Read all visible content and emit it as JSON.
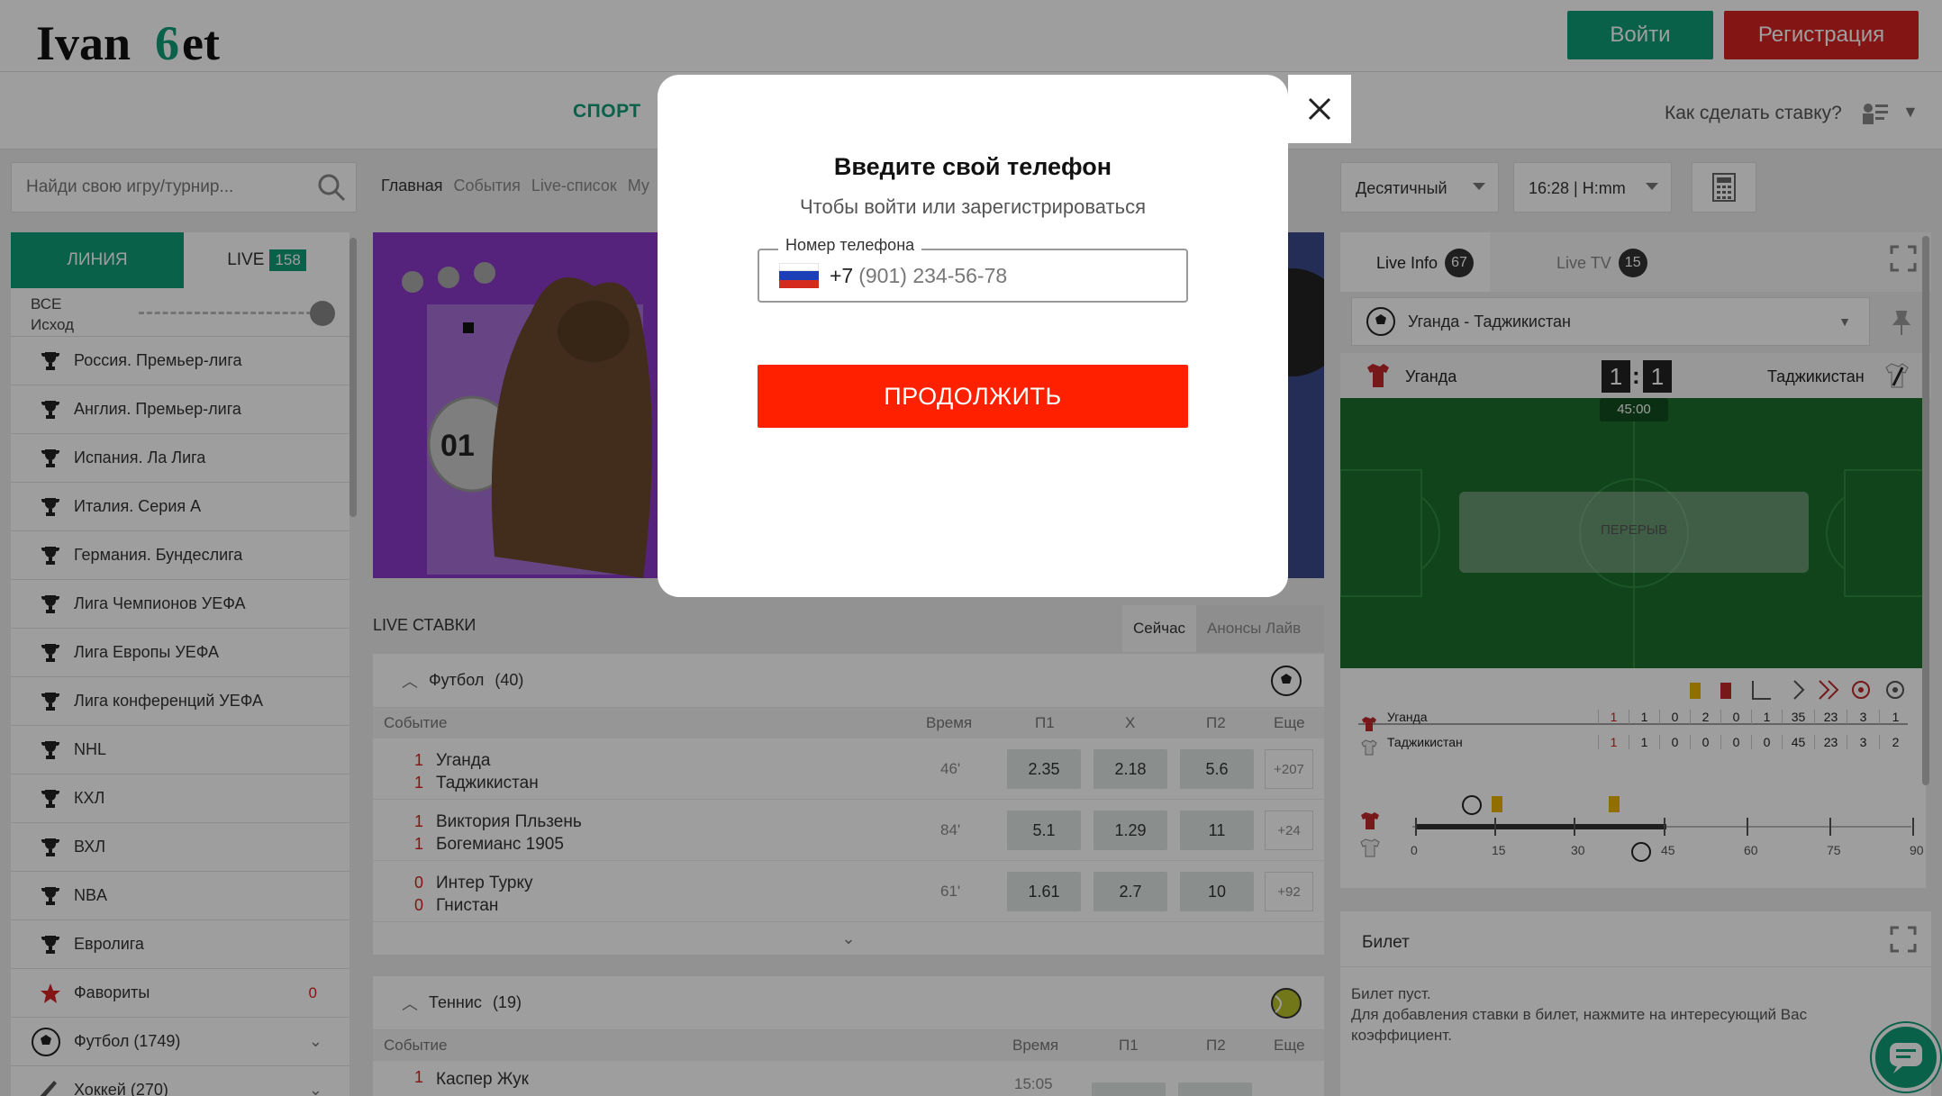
{
  "header": {
    "login_label": "Войти",
    "register_label": "Регистрация",
    "logo_text": "Ivanbet"
  },
  "nav": {
    "sport_label": "СПОРТ",
    "howto_label": "Как сделать ставку?"
  },
  "search": {
    "placeholder": "Найди свою игру/турнир..."
  },
  "breadcrumbs": [
    "Главная",
    "События",
    "Live-список",
    "Му"
  ],
  "settings": {
    "odds_format": "Десятичный",
    "time_format": "16:28 | H:mm"
  },
  "sidebar": {
    "tab_line": "ЛИНИЯ",
    "tab_live": "LIVE",
    "tab_live_count": "158",
    "filter_all": "ВСЕ",
    "filter_outcome": "Исход",
    "leagues": [
      "Россия. Премьер-лига",
      "Англия. Премьер-лига",
      "Испания. Ла Лига",
      "Италия. Серия А",
      "Германия. Бундеслига",
      "Лига Чемпионов УЕФА",
      "Лига Европы УЕФА",
      "Лига конференций УЕФА",
      "NHL",
      "КХЛ",
      "ВХЛ",
      "NBA",
      "Евролига"
    ],
    "favorites_label": "Фавориты",
    "favorites_count": "0",
    "football_label": "Футбол (1749)",
    "hockey_label": "Хоккей (270)"
  },
  "live": {
    "title": "LIVE СТАВКИ",
    "tab_now": "Сейчас",
    "tab_announce": "Анонсы Лайв",
    "football": {
      "title": "Футбол",
      "count": "(40)",
      "columns": {
        "event": "Событие",
        "time": "Время",
        "p1": "П1",
        "x": "Х",
        "p2": "П2",
        "more": "Еще"
      },
      "rows": [
        {
          "score1": "1",
          "score2": "1",
          "team1": "Уганда",
          "team2": "Таджикистан",
          "time": "46'",
          "p1": "2.35",
          "x": "2.18",
          "p2": "5.6",
          "more": "+207"
        },
        {
          "score1": "1",
          "score2": "1",
          "team1": "Виктория Пльзень",
          "team2": "Богемианс 1905",
          "time": "84'",
          "p1": "5.1",
          "x": "1.29",
          "p2": "11",
          "more": "+24"
        },
        {
          "score1": "0",
          "score2": "0",
          "team1": "Интер Турку",
          "team2": "Гнистан",
          "time": "61'",
          "p1": "1.61",
          "x": "2.7",
          "p2": "10",
          "more": "+92"
        }
      ]
    },
    "tennis": {
      "title": "Теннис",
      "count": "(19)",
      "columns": {
        "event": "Событие",
        "time": "Время",
        "p1": "П1",
        "p2": "П2",
        "more": "Еще"
      },
      "row": {
        "score": "1",
        "team": "Каспер Жук",
        "time": "15:05"
      }
    }
  },
  "right": {
    "live_info": "Live Info",
    "live_info_count": "67",
    "live_tv": "Live TV",
    "live_tv_count": "15",
    "match": "Уганда - Таджикистан",
    "team1": "Уганда",
    "team2": "Таджикистан",
    "score1": "1",
    "score2": "1",
    "clock": "45:00",
    "status": "ПЕРЕРЫВ",
    "stats_team1": [
      "1",
      "1",
      "0",
      "2",
      "0",
      "1",
      "35",
      "23",
      "3",
      "1"
    ],
    "stats_team2": [
      "1",
      "1",
      "0",
      "0",
      "0",
      "0",
      "45",
      "23",
      "3",
      "2"
    ],
    "timeline_ticks": [
      "0",
      "15",
      "30",
      "45",
      "60",
      "75",
      "90"
    ],
    "ticket_title": "Билет",
    "ticket_empty": "Билет пуст.",
    "ticket_hint": "Для добавления ставки в билет, нажмите на интересующий Вас коэффициент."
  },
  "modal": {
    "title": "Введите свой телефон",
    "subtitle": "Чтобы войти или зарегистрироваться",
    "phone_label": "Номер телефона",
    "phone_prefix": "+7",
    "phone_placeholder": "(901) 234-56-78",
    "continue_label": "ПРОДОЛЖИТЬ"
  },
  "colors": {
    "brand_green": "#0f9d77",
    "register_red": "#d42321",
    "continue_red": "#ff2000"
  }
}
